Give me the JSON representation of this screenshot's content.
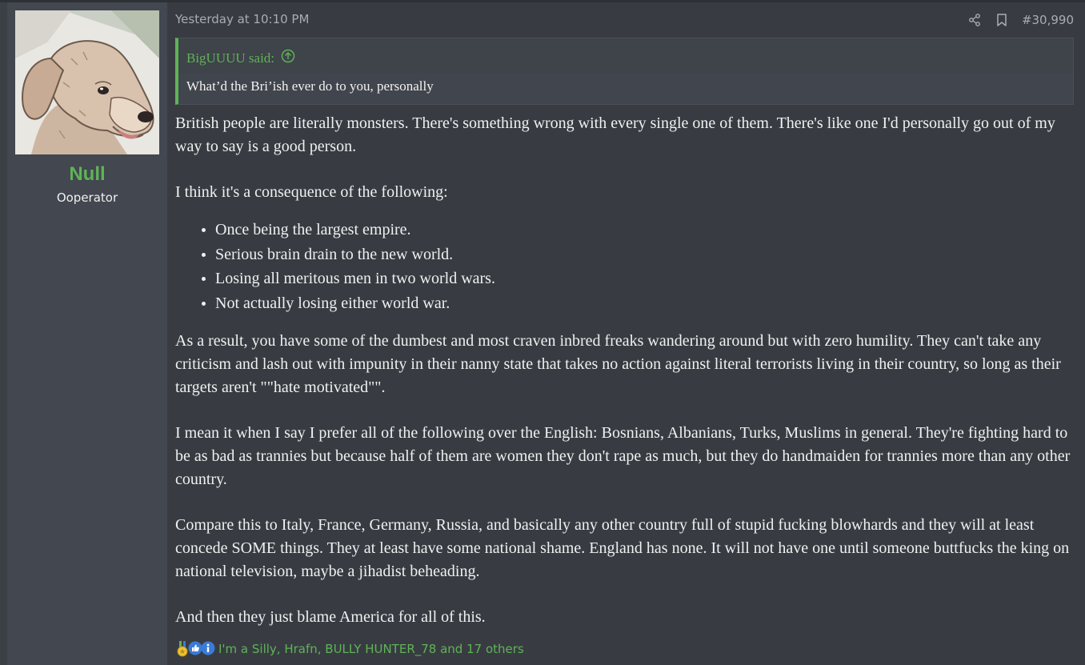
{
  "user": {
    "name": "Null",
    "title": "Ooperator"
  },
  "post": {
    "date": "Yesterday at 10:10 PM",
    "number": "#30,990"
  },
  "quote": {
    "author": "BigUUUU said:",
    "text": "What’d the Bri’ish ever do to you, personally"
  },
  "body": {
    "p1": "British people are literally monsters. There's something wrong with every single one of them. There's like one I'd personally go out of my way to say is a good person.",
    "p2": "I think it's a consequence of the following:",
    "list": [
      "Once being the largest empire.",
      "Serious brain drain to the new world.",
      "Losing all meritous men in two world wars.",
      "Not actually losing either world war."
    ],
    "p3": "As a result, you have some of the dumbest and most craven inbred freaks wandering around but with zero humility. They can't take any criticism and lash out with impunity in their nanny state that takes no action against literal terrorists living in their country, so long as their targets aren't \"\"hate motivated\"\".",
    "p4": "I mean it when I say I prefer all of the following over the English: Bosnians, Albanians, Turks, Muslims in general. They're fighting hard to be as bad as trannies but because half of them are women they don't rape as much, but they do handmaiden for trannies more than any other country.",
    "p5": "Compare this to Italy, France, Germany, Russia, and basically any other country full of stupid fucking blowhards and they will at least concede SOME things. They at least have some national shame. England has none. It will not have one until someone buttfucks the king on national television, maybe a jihadist beheading.",
    "p6": "And then they just blame America for all of this."
  },
  "reactions": {
    "icons": [
      "medal-icon",
      "thumbs-up-icon",
      "info-icon"
    ],
    "text": "I'm a Silly, Hrafn, BULLY HUNTER_78 and 17 others"
  },
  "colors": {
    "accent": "#5fb356",
    "background": "#383c42",
    "sidebar": "#424750",
    "text": "#f0f0f0",
    "muted": "#a8acb3"
  }
}
